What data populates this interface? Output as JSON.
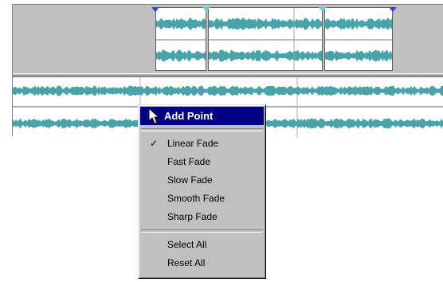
{
  "context_menu": {
    "add_point": "Add Point",
    "items": [
      {
        "label": "Linear Fade",
        "checked": true
      },
      {
        "label": "Fast Fade",
        "checked": false
      },
      {
        "label": "Slow Fade",
        "checked": false
      },
      {
        "label": "Smooth Fade",
        "checked": false
      },
      {
        "label": "Sharp Fade",
        "checked": false
      }
    ],
    "select_all": "Select All",
    "reset_all": "Reset All",
    "check_glyph": "✓"
  },
  "colors": {
    "waveform": "#49a3a9",
    "highlight": "#000080",
    "menu_bg": "#c0c0c0",
    "marker": "#5fd0d8"
  },
  "icons": [
    "mouse-cursor-icon",
    "checkmark-icon",
    "fade-marker-icon"
  ]
}
